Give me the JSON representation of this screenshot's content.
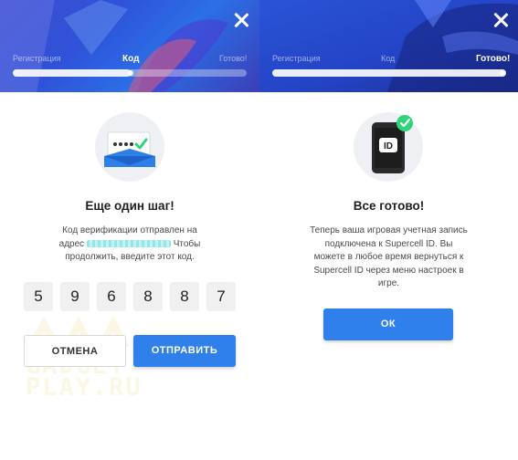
{
  "steps": [
    "Регистрация",
    "Код",
    "Готово!"
  ],
  "left": {
    "active_step": 1,
    "heading": "Еще один шаг!",
    "body_line1": "Код верификации отправлен на",
    "body_line2_prefix": "адрес",
    "body_line2_suffix": "Чтобы",
    "body_line3": "продолжить, введите этот код.",
    "code_digits": [
      "5",
      "9",
      "6",
      "8",
      "8",
      "7"
    ],
    "cancel_label": "ОТМЕНА",
    "submit_label": "ОТПРАВИТЬ",
    "progress_fraction": 0.5,
    "watermark_line1": "GADGET",
    "watermark_line2": "PLAY.RU"
  },
  "right": {
    "active_step": 2,
    "heading": "Все готово!",
    "body_lines": [
      "Теперь ваша игровая учетная запись",
      "подключена к Supercell ID. Вы",
      "можете в любое время вернуться к",
      "Supercell ID через меню настроек в",
      "игре."
    ],
    "id_badge": "ID",
    "ok_label": "ОК",
    "progress_fraction": 1.0
  },
  "colors": {
    "accent": "#2f80ea",
    "success": "#2ed47a",
    "hero_blue": "#2c52d4"
  },
  "icons": [
    "close-icon",
    "envelope-icon",
    "check-icon",
    "phone-icon"
  ]
}
